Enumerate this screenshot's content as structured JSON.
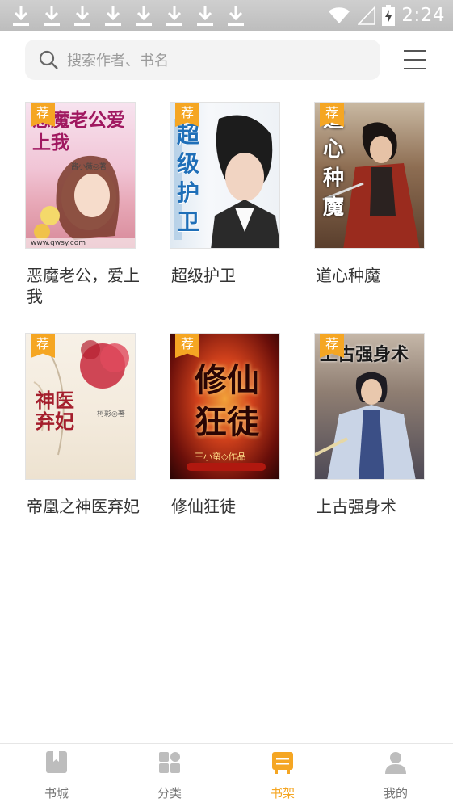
{
  "status_bar": {
    "time": "2:24",
    "download_notifications": 8
  },
  "search": {
    "placeholder": "搜索作者、书名"
  },
  "books": [
    {
      "title": "恶魔老公，爱上我",
      "tag": "荐",
      "cover_text": "恶魔老公爱上我",
      "cover_author": "酱小薇◎著",
      "cover_url": "www.qwsy.com"
    },
    {
      "title": "超级护卫",
      "tag": "荐",
      "cover_text": "超级护卫"
    },
    {
      "title": "道心种魔",
      "tag": "荐",
      "cover_text": "道心种魔"
    },
    {
      "title": "帝凰之神医弃妃",
      "tag": "荐",
      "cover_text": "神医弃妃",
      "cover_author": "柯彩◎著"
    },
    {
      "title": "修仙狂徒",
      "tag": "荐",
      "cover_text": "修仙狂徒",
      "cover_author": "王小蛮◇作品"
    },
    {
      "title": "上古强身术",
      "tag": "荐",
      "cover_text": "上古强身术"
    }
  ],
  "bottom_nav": [
    {
      "label": "书城",
      "icon": "bookstore-icon",
      "active": false
    },
    {
      "label": "分类",
      "icon": "category-grid-icon",
      "active": false
    },
    {
      "label": "书架",
      "icon": "bookshelf-icon",
      "active": true
    },
    {
      "label": "我的",
      "icon": "profile-icon",
      "active": false
    }
  ],
  "colors": {
    "accent": "#f5a623",
    "inactive": "#777777"
  }
}
